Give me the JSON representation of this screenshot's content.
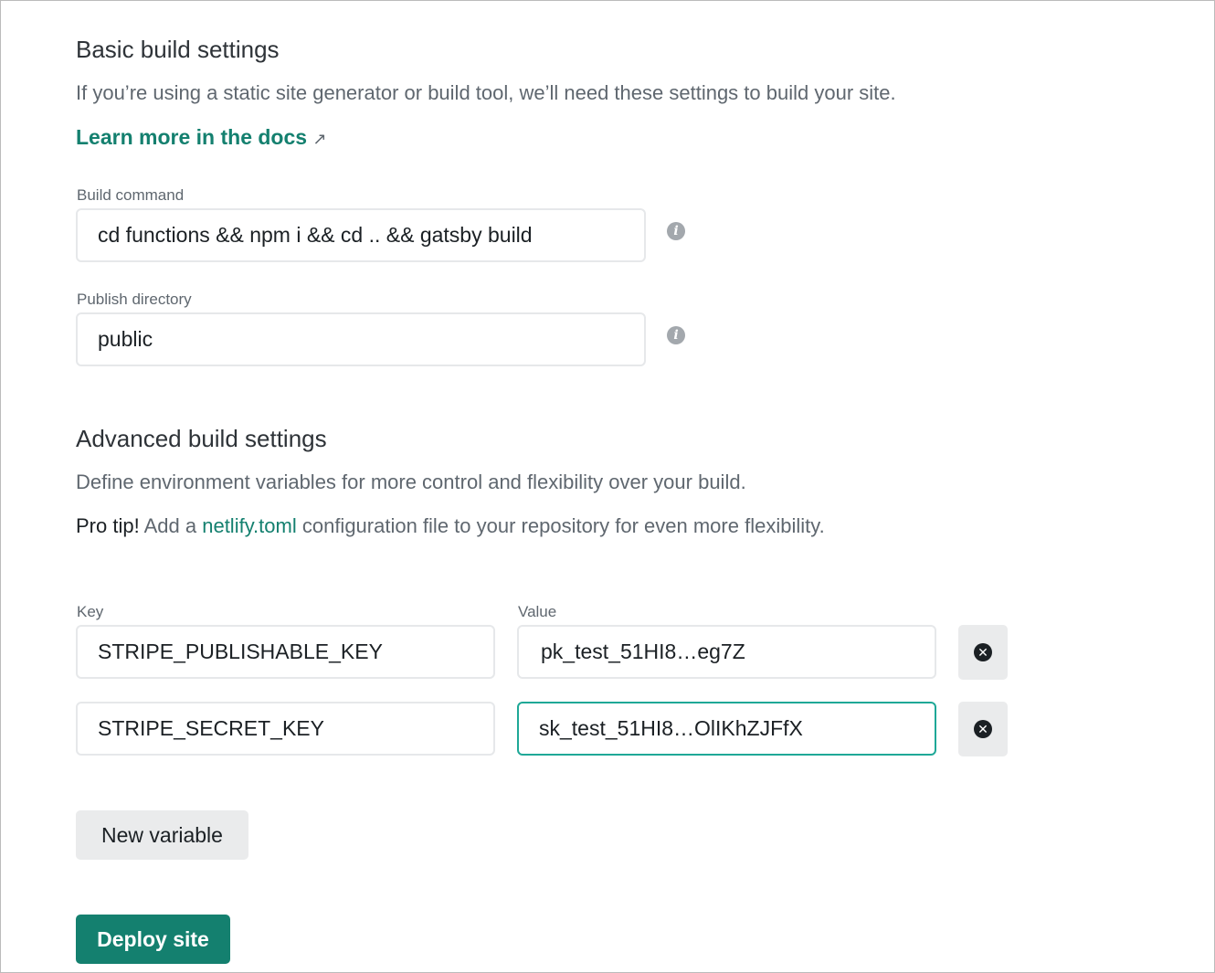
{
  "basic": {
    "title": "Basic build settings",
    "description": "If you’re using a static site generator or build tool, we’ll need these settings to build your site.",
    "docs_link": "Learn more in the docs",
    "docs_icon": "↗",
    "build_command_label": "Build command",
    "build_command_value": "cd functions && npm i && cd .. && gatsby build",
    "publish_dir_label": "Publish directory",
    "publish_dir_value": "public"
  },
  "advanced": {
    "title": "Advanced build settings",
    "description": "Define environment variables for more control and flexibility over your build.",
    "pro_tip_prefix": "Pro tip!",
    "pro_tip_text1": " Add a ",
    "pro_tip_link": "netlify.toml",
    "pro_tip_text2": " configuration file to your repository for even more flexibility.",
    "key_label": "Key",
    "value_label": "Value",
    "variables": [
      {
        "key": "STRIPE_PUBLISHABLE_KEY",
        "value": "pk_test_51HI8…eg7Z"
      },
      {
        "key": "STRIPE_SECRET_KEY",
        "value": "sk_test_51HI8…OlIKhZJFfX"
      }
    ],
    "new_variable_label": "New variable"
  },
  "deploy_label": "Deploy site",
  "colors": {
    "accent": "#14806f",
    "focus": "#1fa897",
    "button_bg": "#eaebec"
  }
}
